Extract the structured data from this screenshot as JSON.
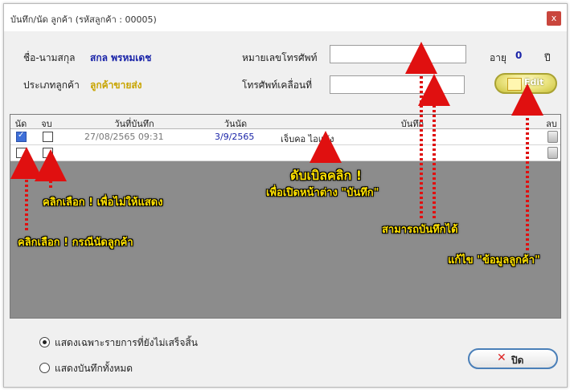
{
  "window": {
    "title": "บันทึก/นัด ลูกค้า (รหัสลูกค้า : 00005)",
    "close_glyph": "x"
  },
  "customer": {
    "name_label": "ชื่อ-นามสกุล",
    "name_value": "สกล พรหมเดช",
    "type_label": "ประเภทลูกค้า",
    "type_value": "ลูกค้าขายส่ง",
    "phone_label": "หมายเลขโทรศัพท์",
    "phone_value": "",
    "mobile_label": "โทรศัพท์เคลื่อนที่",
    "mobile_value": "",
    "age_label": "อายุ",
    "age_value": "0",
    "age_unit": "ปี",
    "edit_button": "Edit"
  },
  "grid": {
    "headers": [
      "นัด",
      "จบ",
      "วันที่บันทึก",
      "วันนัด",
      "บันทึก",
      "ลบ"
    ],
    "rows": [
      {
        "appointment": true,
        "done": false,
        "recorded_at": "27/08/2565 09:31",
        "appointment_date": "3/9/2565",
        "note": "เจ็บคอ ไอแห้ง"
      },
      {
        "appointment": false,
        "done": false,
        "recorded_at": "",
        "appointment_date": "",
        "note": ""
      }
    ]
  },
  "annotations": {
    "double_click_1": "ดับเบิลคลิก !",
    "double_click_2": "เพื่อเปิดหน้าต่าง \"บันทึก\"",
    "click_hide": "คลิกเลือก ! เพื่อไม่ให้แสดง",
    "can_save": "สามารถบันทึกได้",
    "click_appointment": "คลิกเลือก ! กรณีนัดลูกค้า",
    "edit_customer": "แก้ไข \"ข้อมูลลูกค้า\"",
    "color": "#ffe100",
    "arrow_color": "#e01010"
  },
  "footer": {
    "option_pending": "แสดงเฉพาะรายการที่ยังไม่เสร็จสิ้น",
    "option_all": "แสดงบันทึกทั้งหมด",
    "selected": "pending",
    "close_button": "ปิด",
    "close_glyph": "✕"
  },
  "colors": {
    "value_blue": "#1a24a8",
    "type_gold": "#c8a400",
    "grid_bg": "#8c8c8c"
  }
}
